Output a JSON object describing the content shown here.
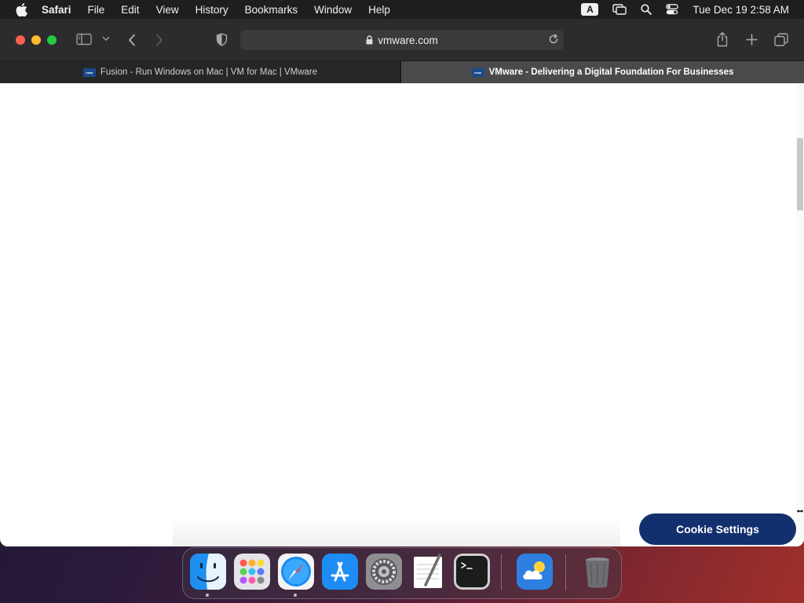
{
  "menubar": {
    "app_name": "Safari",
    "menus": [
      "File",
      "Edit",
      "View",
      "History",
      "Bookmarks",
      "Window",
      "Help"
    ],
    "input_source": "A",
    "clock": "Tue Dec 19  2:58 AM"
  },
  "toolbar": {
    "url": "vmware.com"
  },
  "tabs": [
    {
      "title": "Fusion - Run Windows on Mac | VM for Mac | VMware",
      "active": false,
      "favicon": "vmw"
    },
    {
      "title": "VMware - Delivering a Digital Foundation For Businesses",
      "active": true,
      "favicon": "vmw"
    }
  ],
  "page": {
    "cookie_button": "Cookie Settings"
  },
  "dock": {
    "apps": [
      "Finder",
      "Launchpad",
      "Safari",
      "App Store",
      "System Preferences",
      "TextEdit",
      "Terminal",
      "Weather",
      "Trash"
    ]
  },
  "colors": {
    "cookie_button_bg": "#13306e",
    "active_tab_bg": "#4a4a4c",
    "toolbar_bg": "#2c2c2e"
  }
}
